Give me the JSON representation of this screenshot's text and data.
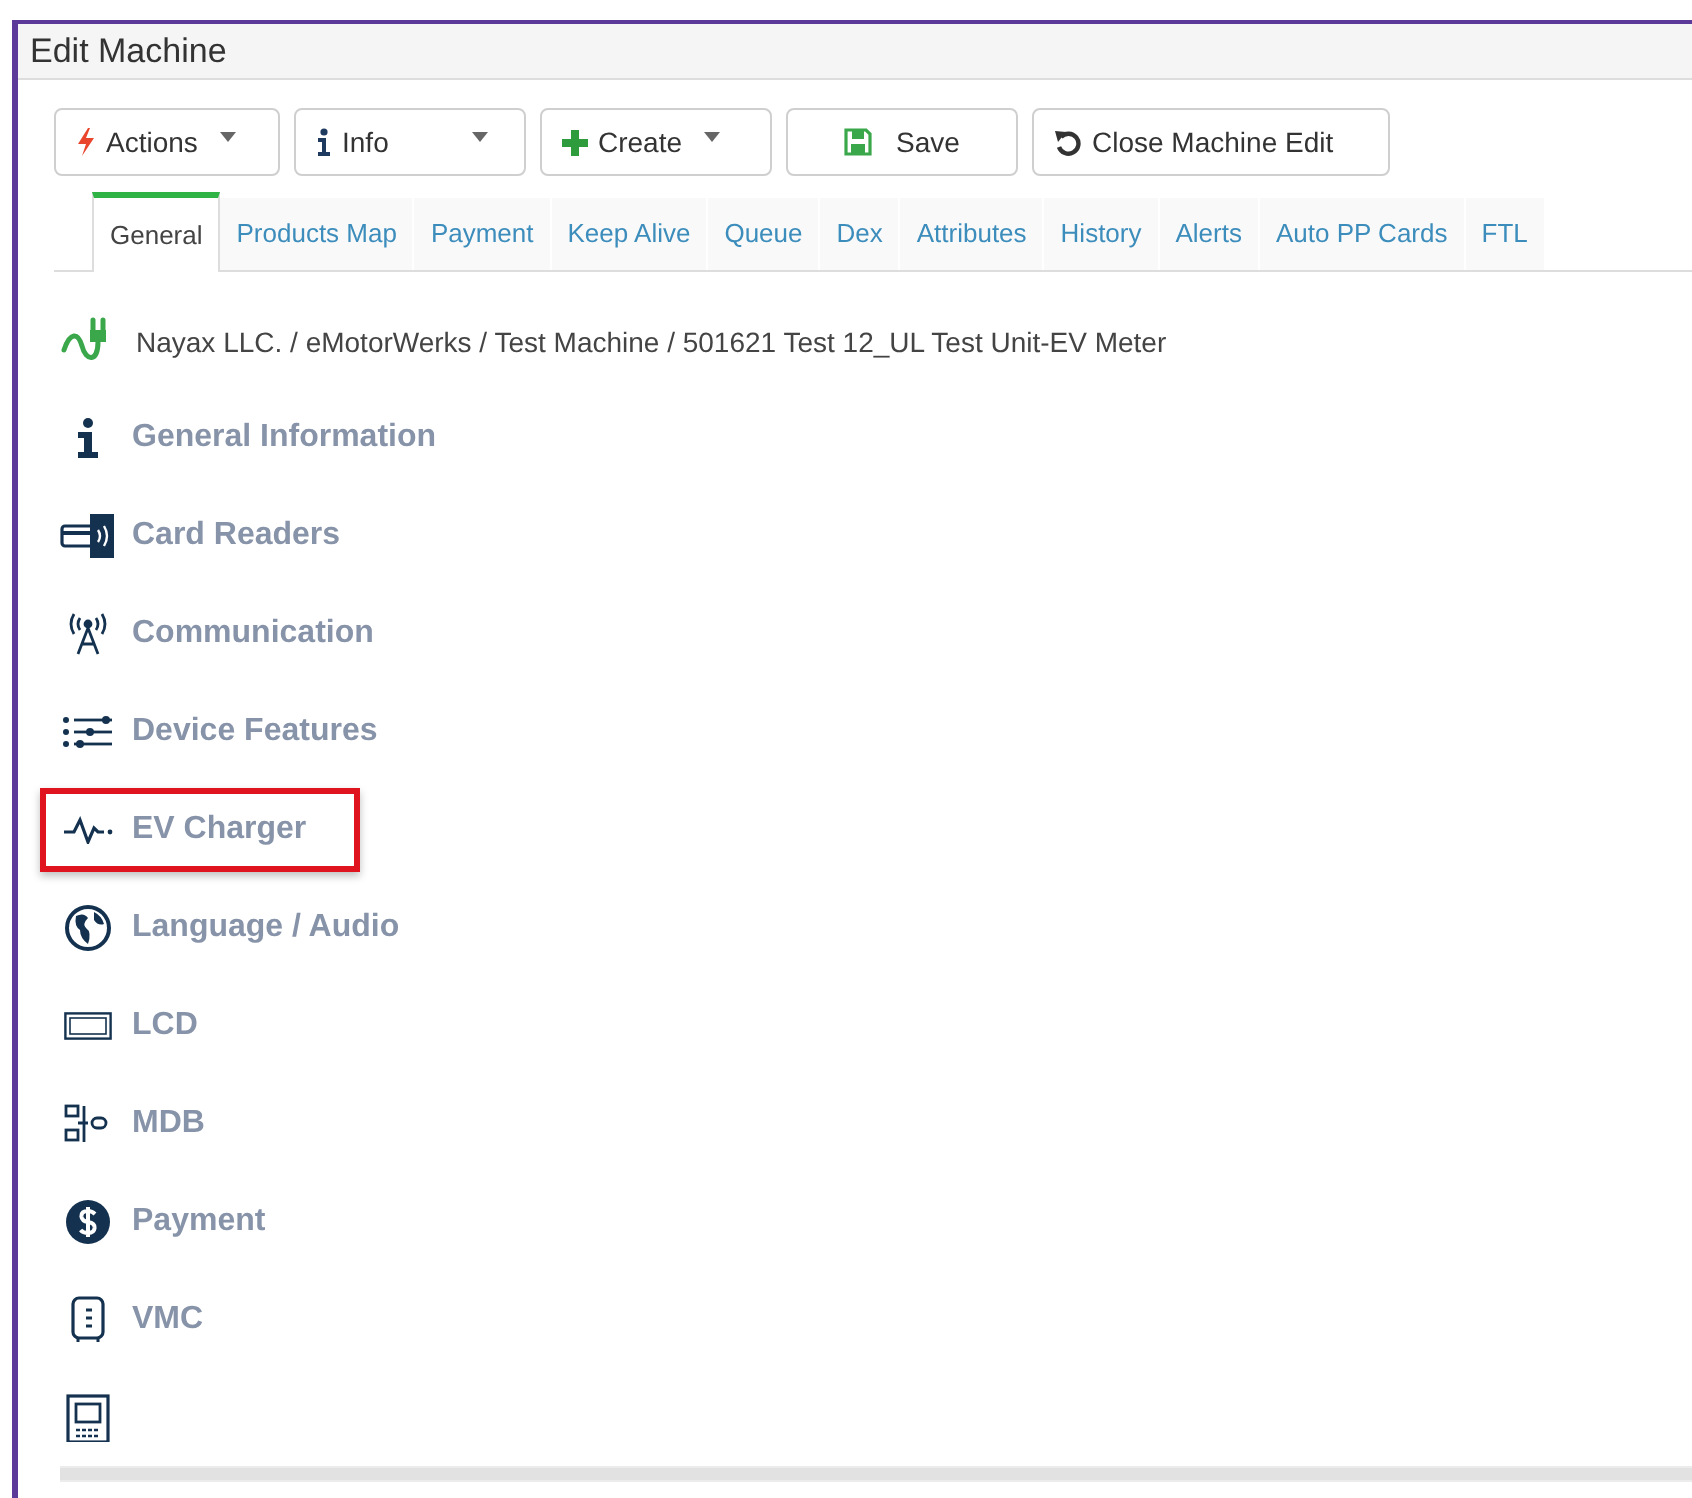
{
  "window": {
    "title": "Edit Machine"
  },
  "toolbar": [
    {
      "kind": "actions",
      "label": "Actions",
      "dropdown": true
    },
    {
      "kind": "info",
      "label": "Info",
      "dropdown": true
    },
    {
      "kind": "create",
      "label": "Create",
      "dropdown": true
    },
    {
      "kind": "save",
      "label": "Save",
      "dropdown": false
    },
    {
      "kind": "undo",
      "label": "Close Machine Edit",
      "dropdown": false
    }
  ],
  "tabs": [
    {
      "label": "General",
      "selected": true
    },
    {
      "label": "Products Map",
      "selected": false
    },
    {
      "label": "Payment",
      "selected": false
    },
    {
      "label": "Keep Alive",
      "selected": false
    },
    {
      "label": "Queue",
      "selected": false
    },
    {
      "label": "Dex",
      "selected": false
    },
    {
      "label": "Attributes",
      "selected": false
    },
    {
      "label": "History",
      "selected": false
    },
    {
      "label": "Alerts",
      "selected": false
    },
    {
      "label": "Auto PP Cards",
      "selected": false
    },
    {
      "label": "FTL",
      "selected": false
    }
  ],
  "breadcrumb": "Nayax LLC. / eMotorWerks / Test Machine / 501621 Test 12_UL Test Unit-EV Meter",
  "sections": [
    {
      "kind": "info",
      "label": "General Information",
      "highlighted": false
    },
    {
      "kind": "card",
      "label": "Card Readers",
      "highlighted": false
    },
    {
      "kind": "antenna",
      "label": "Communication",
      "highlighted": false
    },
    {
      "kind": "features",
      "label": "Device Features",
      "highlighted": false
    },
    {
      "kind": "pulse",
      "label": "EV Charger",
      "highlighted": true
    },
    {
      "kind": "globe",
      "label": "Language / Audio",
      "highlighted": false
    },
    {
      "kind": "lcd",
      "label": "LCD",
      "highlighted": false
    },
    {
      "kind": "mdb",
      "label": "MDB",
      "highlighted": false
    },
    {
      "kind": "dollar",
      "label": "Payment",
      "highlighted": false
    },
    {
      "kind": "vmc",
      "label": "VMC",
      "highlighted": false
    },
    {
      "kind": "terminal",
      "highlighted": false
    }
  ]
}
